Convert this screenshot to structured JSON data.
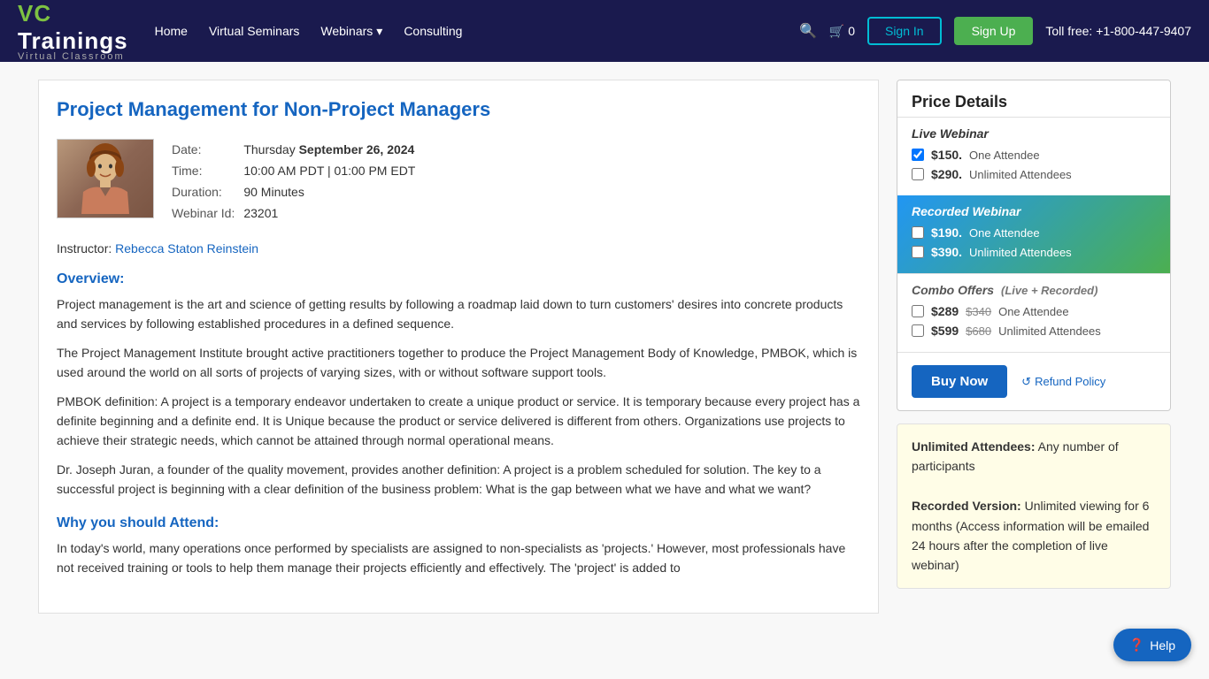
{
  "nav": {
    "logo_vc": "VC",
    "logo_trainings": "Trainings",
    "logo_sub": "Virtual Classroom",
    "links": [
      {
        "label": "Home",
        "name": "home-link"
      },
      {
        "label": "Virtual Seminars",
        "name": "virtual-seminars-link"
      },
      {
        "label": "Webinars",
        "name": "webinars-link"
      },
      {
        "label": "Consulting",
        "name": "consulting-link"
      }
    ],
    "cart_label": "0",
    "signin_label": "Sign In",
    "signup_label": "Sign Up",
    "phone": "Toll free: +1-800-447-9407"
  },
  "page": {
    "title": "Project Management for Non-Project Managers"
  },
  "details": {
    "date_label": "Date:",
    "date_day": "Thursday ",
    "date_value": "September 26, 2024",
    "time_label": "Time:",
    "time_value": "10:00 AM PDT | 01:00 PM EDT",
    "duration_label": "Duration:",
    "duration_value": "90 Minutes",
    "webinar_id_label": "Webinar Id:",
    "webinar_id_value": "23201",
    "instructor_label": "Instructor:",
    "instructor_name": "Rebecca Staton Reinstein"
  },
  "overview": {
    "heading": "Overview:",
    "para1": "Project management is the art and science of getting results by following a roadmap laid down to turn customers' desires into concrete products and services by following established procedures in a defined sequence.",
    "para2": "The Project Management Institute brought active practitioners together to produce the Project Management Body of Knowledge, PMBOK, which is used around the world on all sorts of projects of varying sizes, with or without software support tools.",
    "para3": "PMBOK definition: A project is a temporary endeavor undertaken to create a unique product or service. It is temporary because every project has a definite beginning and a definite end. It is Unique because the product or service delivered is different from others. Organizations use projects to achieve their strategic needs, which cannot be attained through normal operational means.",
    "para4": "Dr. Joseph Juran, a founder of the quality movement, provides another definition: A project is a problem scheduled for solution. The key to a successful project is beginning with a clear definition of the business problem: What is the gap between what we have and what we want?",
    "why_heading": "Why you should Attend:",
    "why_para": "In today's world, many operations once performed by specialists are assigned to non-specialists as 'projects.' However, most professionals have not received training or tools to help them manage their projects efficiently and effectively. The 'project' is added to"
  },
  "pricing": {
    "header": "Price Details",
    "live_label": "Live Webinar",
    "live_price1": "$150.",
    "live_attendee1": "One Attendee",
    "live_price2": "$290.",
    "live_attendee2": "Unlimited Attendees",
    "recorded_label": "Recorded Webinar",
    "recorded_price1": "$190.",
    "recorded_attendee1": "One Attendee",
    "recorded_price2": "$390.",
    "recorded_attendee2": "Unlimited Attendees",
    "combo_label": "Combo Offers",
    "combo_sub": "(Live + Recorded)",
    "combo_price1": "$289",
    "combo_original1": "$340",
    "combo_attendee1": "One Attendee",
    "combo_price2": "$599",
    "combo_original2": "$680",
    "combo_attendee2": "Unlimited Attendees",
    "buy_now": "Buy Now",
    "refund": "Refund Policy",
    "info_unlimited_label": "Unlimited Attendees:",
    "info_unlimited": "Any number of participants",
    "info_recorded_label": "Recorded Version:",
    "info_recorded": "Unlimited viewing for 6 months (Access information will be emailed 24 hours after the completion of live webinar)"
  },
  "help": {
    "label": "Help"
  }
}
